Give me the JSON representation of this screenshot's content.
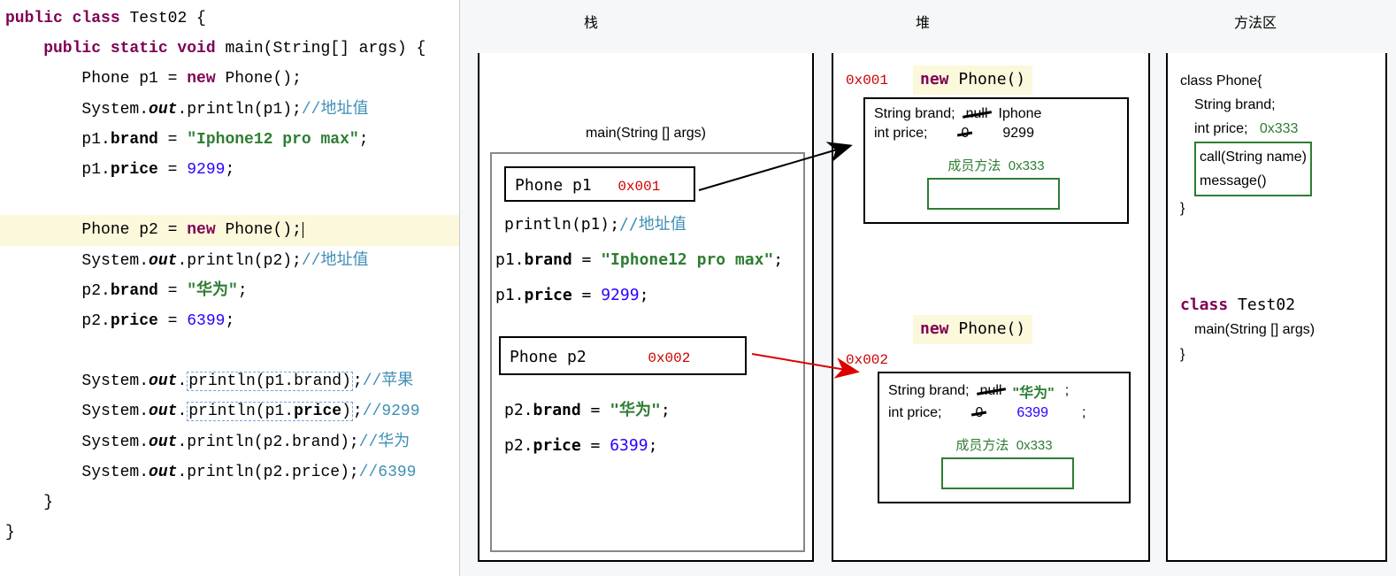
{
  "headers": {
    "stack": "栈",
    "heap": "堆",
    "method_area": "方法区"
  },
  "code": {
    "l1a": "public class ",
    "l1b": "Test02 {",
    "l2a": "    public static void ",
    "l2b": "main(String[] args) {",
    "l3a": "        Phone p1 = ",
    "l3b": "new ",
    "l3c": "Phone();",
    "l4a": "        System.",
    "l4b": "out",
    "l4c": ".println(p1);",
    "l4d": "//地址值",
    "l5a": "        p1.",
    "l5b": "brand",
    "l5c": " = ",
    "l5d": "\"Iphone12 pro max\"",
    "l5e": ";",
    "l6a": "        p1.",
    "l6b": "price",
    "l6c": " = ",
    "l6d": "9299",
    "l6e": ";",
    "l7a": "        Phone p2 = ",
    "l7b": "new ",
    "l7c": "Phone();",
    "l8a": "        System.",
    "l8b": "out",
    "l8c": ".println(p2);",
    "l8d": "//地址值",
    "l9a": "        p2.",
    "l9b": "brand",
    "l9c": " = ",
    "l9d": "\"华为\"",
    "l9e": ";",
    "l10a": "        p2.",
    "l10b": "price",
    "l10c": " = ",
    "l10d": "6399",
    "l10e": ";",
    "l11a": "        System.",
    "l11b": "out",
    "l11c": ".",
    "l11d": "println(p1.brand)",
    "l11dd": ";",
    "l11e": "//苹果",
    "l12a": "        System.",
    "l12b": "out",
    "l12c": ".",
    "l12d": "println(p1.",
    "l12dp": "price",
    "l12dd": ")",
    "l12ds": ";",
    "l12e": "//9299",
    "l13a": "        System.",
    "l13b": "out",
    "l13c": ".println(p2.brand);",
    "l13e": "//华为",
    "l14a": "        System.",
    "l14b": "out",
    "l14c": ".println(p2.price);",
    "l14e": "//6399",
    "l15": "    }",
    "l16": "}"
  },
  "stack": {
    "main_label": "main(String [] args)",
    "p1_label": "Phone p1",
    "p1_addr": "0x001",
    "println_p1a": "println(p1);",
    "println_p1b": "//地址值",
    "brand_a": "p1.",
    "brand_b": "brand",
    "brand_c": " = ",
    "brand_d": "\"Iphone12 pro max\"",
    "brand_e": ";",
    "price_a": "p1.",
    "price_b": "price",
    "price_c": " = ",
    "price_d": "9299",
    "price_e": ";",
    "p2_label": "Phone p2",
    "p2_addr": "0x002",
    "brand2_a": "p2.",
    "brand2_b": "brand",
    "brand2_c": " = ",
    "brand2_d": "\"华为\"",
    "brand2_e": ";",
    "price2_a": "p2.",
    "price2_b": "price",
    "price2_c": " = ",
    "price2_d": "6399",
    "price2_e": ";"
  },
  "heap": {
    "obj1_addr": "0x001",
    "new_kw": "new ",
    "phone_ctor": "Phone()",
    "brand_label": "String brand;",
    "price_label": "int price;",
    "null_txt": "null",
    "zero_txt": "0",
    "obj1_brand_val": "Iphone",
    "obj1_price_val": "9299",
    "member_method": "成员方法",
    "member_addr": "0x333",
    "obj2_addr": "0x002",
    "obj2_brand_val": "\"华为\"",
    "obj2_brand_semi": ";",
    "obj2_price_val": "6399",
    "obj2_price_semi": ";"
  },
  "method": {
    "class_phone": "class Phone{",
    "brand_field": "String brand;",
    "price_field": "int price;",
    "addr": "0x333",
    "call": "call(String name)",
    "message": "message()",
    "close": "}",
    "class_test_kw": "class ",
    "class_test": "Test02",
    "main_sig": "main(String [] args)",
    "close2": "}"
  }
}
